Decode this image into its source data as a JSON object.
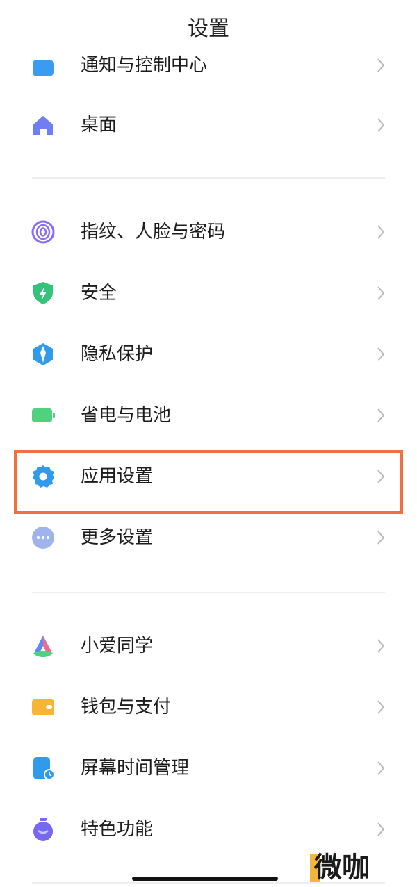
{
  "header": {
    "title": "设置"
  },
  "items": [
    {
      "label": "通知与控制中心",
      "icon": "notification-icon",
      "color": "#3b9bf0"
    },
    {
      "label": "桌面",
      "icon": "home-icon",
      "color": "#6f7ef5"
    },
    {
      "label": "指纹、人脸与密码",
      "icon": "fingerprint-icon",
      "color": "#8a6cf0"
    },
    {
      "label": "安全",
      "icon": "shield-icon",
      "color": "#35c27a"
    },
    {
      "label": "隐私保护",
      "icon": "privacy-icon",
      "color": "#2f9bea"
    },
    {
      "label": "省电与电池",
      "icon": "battery-icon",
      "color": "#4fd27e"
    },
    {
      "label": "应用设置",
      "icon": "gear-icon",
      "color": "#2f9bea"
    },
    {
      "label": "更多设置",
      "icon": "more-icon",
      "color": "#9fb4ec"
    },
    {
      "label": "小爱同学",
      "icon": "xiaoai-icon",
      "color": "#f16a8f"
    },
    {
      "label": "钱包与支付",
      "icon": "wallet-icon",
      "color": "#f6b534"
    },
    {
      "label": "屏幕时间管理",
      "icon": "screen-time-icon",
      "color": "#2f9bea"
    },
    {
      "label": "特色功能",
      "icon": "features-icon",
      "color": "#7668f0"
    }
  ],
  "highlight_color": "#f07040",
  "watermark": {
    "text": "微咖"
  }
}
